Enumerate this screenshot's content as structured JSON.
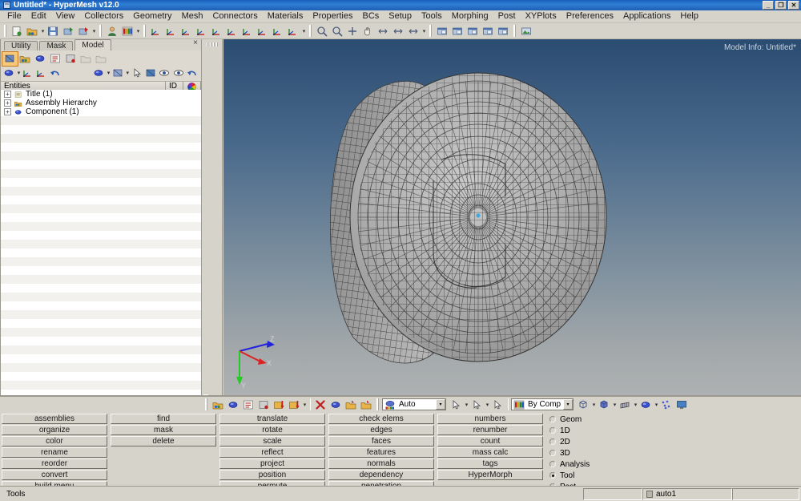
{
  "window": {
    "title": "Untitled* - HyperMesh v12.0",
    "icon": "hypermesh-icon",
    "buttons": [
      {
        "name": "minimize-button",
        "glyph": "_"
      },
      {
        "name": "maximize-button",
        "glyph": "❐"
      },
      {
        "name": "close-button",
        "glyph": "✕"
      }
    ]
  },
  "menubar": {
    "items": [
      "File",
      "Edit",
      "View",
      "Collectors",
      "Geometry",
      "Mesh",
      "Connectors",
      "Materials",
      "Properties",
      "BCs",
      "Setup",
      "Tools",
      "Morphing",
      "Post",
      "XYPlots",
      "Preferences",
      "Applications",
      "Help"
    ]
  },
  "toolbar_top": {
    "groups": [
      {
        "name": "file-group",
        "icons": [
          "new-model-icon",
          "open-model-icon",
          "save-model-icon",
          "import-icon",
          "export-icon"
        ]
      },
      {
        "name": "user-group",
        "icons": [
          "user-profile-icon",
          "color-palette-icon"
        ]
      },
      {
        "name": "view-group",
        "icons": [
          "fit-view-icon",
          "back-view-icon",
          "xy-plane-icon",
          "yx-plane-icon",
          "zx-plane-icon",
          "xz-plane-icon",
          "yz-plane-icon",
          "zy-plane-icon",
          "iso-view-icon",
          "normal-view-icon"
        ]
      },
      {
        "name": "zoom-group",
        "icons": [
          "zoom-window-icon",
          "zoom-icon",
          "center-icon",
          "pan-hand-icon",
          "arrow-rotate-icon",
          "rotate-vertical-icon",
          "rotate-free-icon"
        ]
      },
      {
        "name": "window-group",
        "icons": [
          "single-window-icon",
          "two-window-icon",
          "stacked-window-icon",
          "four-window-icon",
          "multi-window-icon"
        ]
      },
      {
        "name": "capture-group",
        "icons": [
          "screen-capture-icon"
        ]
      }
    ]
  },
  "browser": {
    "tabs": [
      {
        "label": "Utility",
        "active": false
      },
      {
        "label": "Mask",
        "active": false
      },
      {
        "label": "Model",
        "active": true
      }
    ],
    "close_glyph": "×",
    "tool_row_1": [
      "display-model-icon",
      "assembly-icon",
      "component-icon",
      "card-icon",
      "include-icon",
      "ghost1-icon",
      "ghost2-icon"
    ],
    "tool_row_2": [
      "show-component-icon",
      "isolate-icon",
      "isolate-only-icon",
      "reverse-icon",
      "color-component-icon",
      "color-by-icon",
      "pointer-icon",
      "highlight-icon",
      "show-all-icon",
      "show-one-icon",
      "undo-display-icon"
    ],
    "columns": [
      {
        "name": "entities-column",
        "label": "Entities"
      },
      {
        "name": "id-column",
        "label": "ID"
      },
      {
        "name": "color-column",
        "label": ""
      }
    ],
    "tree": [
      {
        "label": "Title (1)",
        "icon": "title-icon",
        "expander": "+"
      },
      {
        "label": "Assembly Hierarchy",
        "icon": "assembly-icon",
        "expander": "+"
      },
      {
        "label": "Component (1)",
        "icon": "component-icon",
        "expander": "+"
      }
    ]
  },
  "vertical_toolbar": {
    "icons": [
      "shaded-geometry-icon",
      "wireframe-mesh-icon",
      "hidden-line-icon",
      "mesh-lines-icon",
      "shaded-elements-icon",
      "transparent-icon",
      "visualization-icon",
      "node-info-icon",
      "numbers-123-icon",
      "text-abc-icon",
      "text-abc-2-icon",
      "contour-icon"
    ]
  },
  "graphics": {
    "model_info": "Model Info: Untitled*",
    "background_top": "#2b4c71",
    "background_bottom": "#aeb1b2",
    "mesh_color": "#a9a9a9",
    "triad": {
      "z_label": "Z",
      "z_color": "#2222dd",
      "x_label": "X",
      "x_color": "#dd2222",
      "y_label": "Y",
      "y_color": "#22cc22"
    }
  },
  "command_toolbar": {
    "icons_left": [
      "assemblies-icon",
      "components-icon",
      "card-edit-icon",
      "include-edit-icon",
      "load-collector-icon",
      "system-collector-icon"
    ],
    "icons_delete": [
      "delete-icon",
      "sphere-icon",
      "organize-icon",
      "find-icon"
    ],
    "select_mode": {
      "name": "entity-select",
      "value": "Auto",
      "icon": "auto-select-icon"
    },
    "pick_icons": [
      "pick-by-path-icon",
      "pick-region-icon",
      "pick-box-icon"
    ],
    "color_mode": {
      "name": "color-mode-select",
      "value": "By Comp",
      "icon": "color-swatch-icon"
    },
    "display_icons": [
      "wireframe-cube-icon",
      "shaded-cube-icon",
      "feature-lines-icon",
      "surface-icon",
      "nodes-icon",
      "monitor-icon"
    ]
  },
  "panel_buttons": {
    "col1": [
      "assemblies",
      "organize",
      "color",
      "rename",
      "reorder",
      "convert",
      "build menu"
    ],
    "col2": [
      "find",
      "mask",
      "delete",
      "",
      "",
      "",
      ""
    ],
    "col3": [
      "translate",
      "rotate",
      "scale",
      "reflect",
      "project",
      "position",
      "permute"
    ],
    "col4": [
      "check elems",
      "edges",
      "faces",
      "features",
      "normals",
      "dependency",
      "penetration"
    ],
    "col5": [
      "numbers",
      "renumber",
      "count",
      "mass calc",
      "tags",
      "HyperMorph",
      ""
    ]
  },
  "page_radios": {
    "options": [
      {
        "label": "Geom",
        "selected": false
      },
      {
        "label": "1D",
        "selected": false
      },
      {
        "label": "2D",
        "selected": false
      },
      {
        "label": "3D",
        "selected": false
      },
      {
        "label": "Analysis",
        "selected": false
      },
      {
        "label": "Tool",
        "selected": true
      },
      {
        "label": "Post",
        "selected": false
      }
    ]
  },
  "statusbar": {
    "message": "Tools",
    "field1": "",
    "field2": "auto1",
    "field3": ""
  }
}
